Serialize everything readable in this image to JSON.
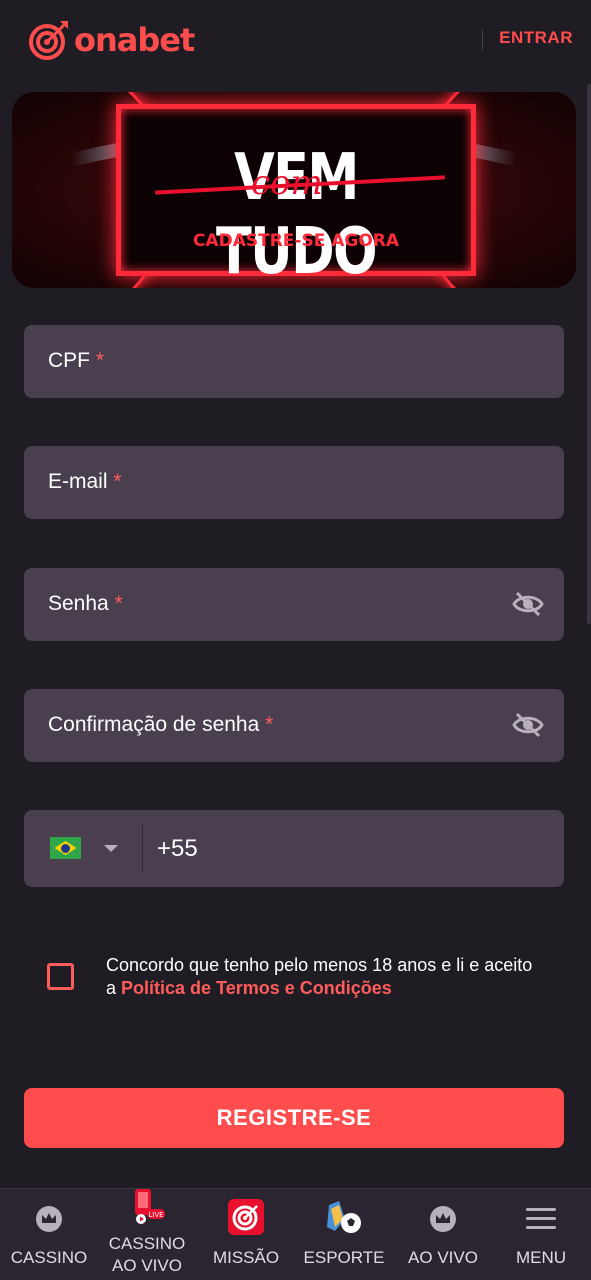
{
  "header": {
    "logo_text": "onabet",
    "login_label": "ENTRAR"
  },
  "banner": {
    "title": "VEM TUDO",
    "script_word": "com",
    "subtitle": "CADASTRE-SE AGORA"
  },
  "form": {
    "cpf_label": "CPF",
    "email_label": "E-mail",
    "password_label": "Senha",
    "confirm_password_label": "Confirmação de senha",
    "required_mark": "*",
    "phone_code": "+55",
    "phone_country": "Brazil",
    "terms_text": "Concordo que tenho pelo menos 18 anos e li e aceito a ",
    "terms_link": "Política de Termos e Condições",
    "terms_checked": false,
    "submit_label": "REGISTRE-SE"
  },
  "bottom_nav": {
    "items": [
      {
        "label": "CASSINO",
        "icon": "crown-icon"
      },
      {
        "label": "CASSINO\nAO VIVO",
        "icon": "live-casino-icon"
      },
      {
        "label": "MISSÃO",
        "icon": "target-icon"
      },
      {
        "label": "ESPORTE",
        "icon": "soccer-icon"
      },
      {
        "label": "AO VIVO",
        "icon": "crown-icon"
      },
      {
        "label": "MENU",
        "icon": "hamburger-icon"
      }
    ]
  },
  "colors": {
    "brand": "#ff4d4d",
    "background": "#1f1c24",
    "field": "#4a3f4f"
  }
}
